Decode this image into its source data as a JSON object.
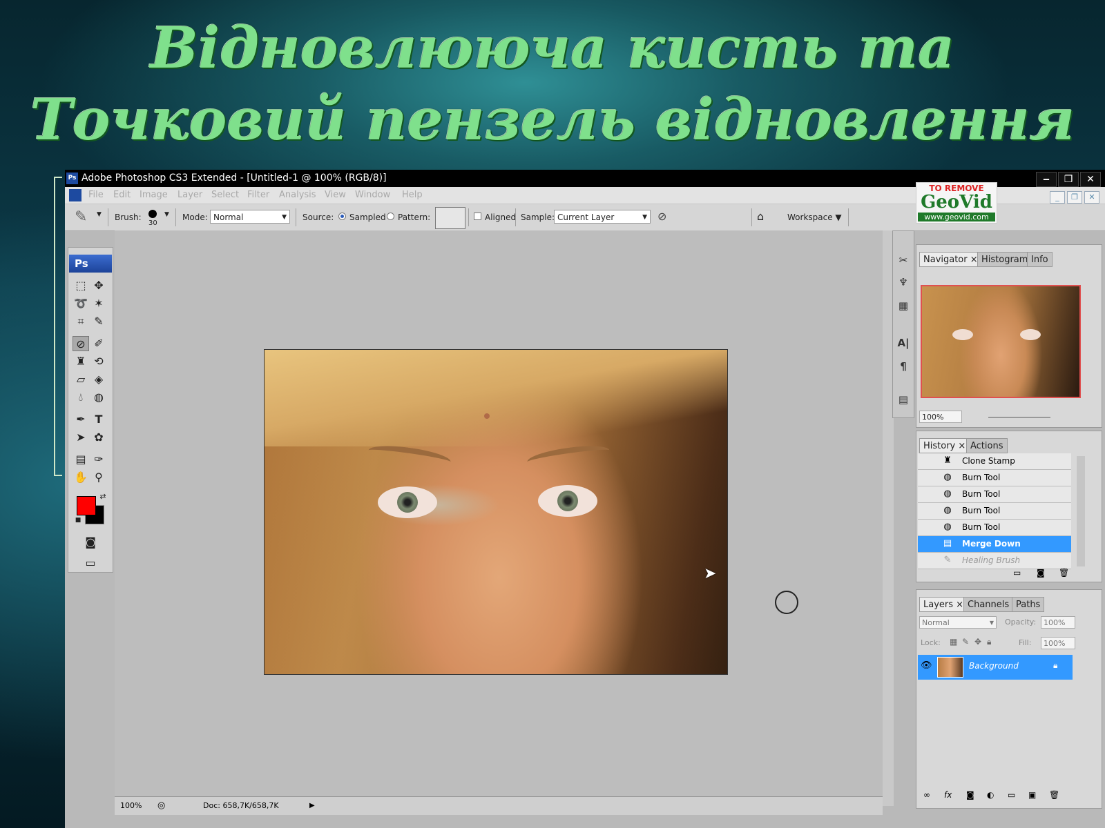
{
  "slide": {
    "title_line1": "Відновлююча кисть та",
    "title_line2": "Точковий пензель відновлення"
  },
  "window": {
    "title": "Adobe Photoshop CS3 Extended - [Untitled-1 @ 100% (RGB/8)]",
    "app_icon": "Ps",
    "controls": [
      "‒",
      "❐",
      "✕"
    ]
  },
  "menu": [
    "File",
    "Edit",
    "Image",
    "Layer",
    "Select",
    "Filter",
    "Analysis",
    "View",
    "Window",
    "Help"
  ],
  "watermark": {
    "line1": "TO REMOVE",
    "line2": "GeoVid",
    "line3": "www.geovid.com"
  },
  "options": {
    "brush_label": "Brush:",
    "brush_size": "30",
    "mode_label": "Mode:",
    "mode_value": "Normal",
    "source_label": "Source:",
    "sampled_label": "Sampled",
    "pattern_label": "Pattern:",
    "aligned_label": "Aligned",
    "sample_label": "Sample:",
    "sample_value": "Current Layer",
    "workspace_label": "Workspace ▼"
  },
  "toolbox": {
    "logo": "Ps"
  },
  "colors": {
    "foreground": "#ff0000",
    "background": "#000000",
    "selection": "#3399ff"
  },
  "status": {
    "zoom": "100%",
    "doc": "Doc: 658,7K/658,7K"
  },
  "navigator": {
    "tabs": [
      "Navigator",
      "Histogram",
      "Info"
    ],
    "zoom": "100%"
  },
  "history": {
    "tabs": [
      "History",
      "Actions"
    ],
    "items": [
      {
        "label": "Clone Stamp",
        "icon": "stamp-icon"
      },
      {
        "label": "Burn Tool",
        "icon": "burn-icon"
      },
      {
        "label": "Burn Tool",
        "icon": "burn-icon"
      },
      {
        "label": "Burn Tool",
        "icon": "burn-icon"
      },
      {
        "label": "Burn Tool",
        "icon": "burn-icon"
      },
      {
        "label": "Merge Down",
        "icon": "merge-icon"
      },
      {
        "label": "Healing Brush",
        "icon": "healing-brush-icon"
      }
    ],
    "selected_index": 5
  },
  "layers": {
    "tabs": [
      "Layers",
      "Channels",
      "Paths"
    ],
    "blend_mode": "Normal",
    "opacity_label": "Opacity:",
    "opacity_value": "100%",
    "lock_label": "Lock:",
    "fill_label": "Fill:",
    "fill_value": "100%",
    "layer_name": "Background"
  }
}
